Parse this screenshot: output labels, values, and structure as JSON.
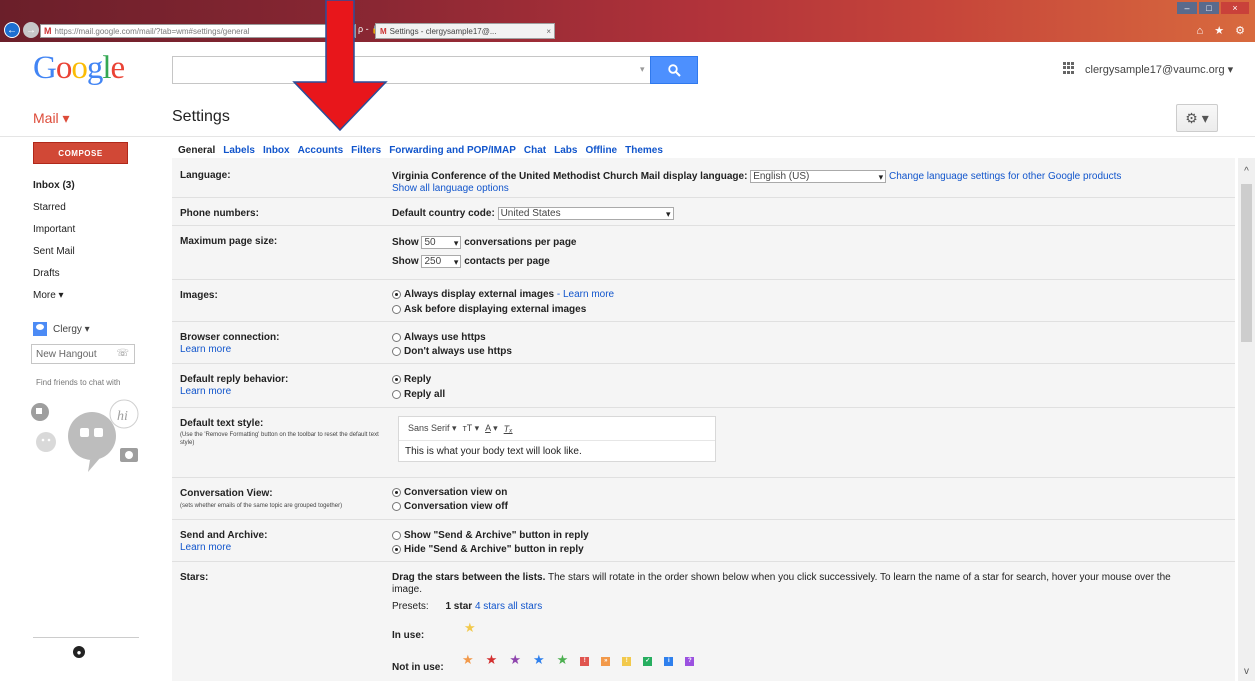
{
  "browser": {
    "url": "https://mail.google.com/mail/?tab=wm#settings/general",
    "tab_title": "Settings - clergysample17@...",
    "tab_close": "×",
    "addr_controls": "ρ - 🔒 C",
    "right_icons": "⌂ ★ ⚙"
  },
  "header": {
    "logo": "Google",
    "account": "clergysample17@vaumc.org ▾"
  },
  "mailbar": {
    "mail_label": "Mail ▾",
    "title": "Settings",
    "gear": "⚙ ▾"
  },
  "nav": {
    "compose": "COMPOSE",
    "items": [
      "Inbox (3)",
      "Starred",
      "Important",
      "Sent Mail",
      "Drafts",
      "More ▾"
    ],
    "hangout_user": "Clergy ▾",
    "hangout_placeholder": "New Hangout",
    "find_friends": "Find friends to chat with"
  },
  "tabs": [
    "General",
    "Labels",
    "Inbox",
    "Accounts",
    "Filters",
    "Forwarding and POP/IMAP",
    "Chat",
    "Labs",
    "Offline",
    "Themes"
  ],
  "settings": {
    "language": {
      "label": "Language:",
      "prefix": "Virginia Conference of the United Methodist Church Mail display language:",
      "value": "English (US)",
      "change_link": "Change language settings for other Google products",
      "show_all": "Show all language options"
    },
    "phone": {
      "label": "Phone numbers:",
      "prefix": "Default country code:",
      "value": "United States"
    },
    "page_size": {
      "label": "Maximum page size:",
      "show": "Show",
      "conv_value": "50",
      "conv_suffix": "conversations per page",
      "contacts_value": "250",
      "contacts_suffix": "contacts per page"
    },
    "images": {
      "label": "Images:",
      "opt1": "Always display external images",
      "opt1_link": "- Learn more",
      "opt2": "Ask before displaying external images"
    },
    "browser_conn": {
      "label": "Browser connection:",
      "learn": "Learn more",
      "opt1": "Always use https",
      "opt2": "Don't always use https"
    },
    "reply": {
      "label": "Default reply behavior:",
      "learn": "Learn more",
      "opt1": "Reply",
      "opt2": "Reply all"
    },
    "text_style": {
      "label": "Default text style:",
      "note": "(Use the 'Remove Formatting' button on the toolbar to reset the default text style)",
      "font": "Sans Serif",
      "font_caret": "▾",
      "size_icon": "ᴛT",
      "size_caret": "▾",
      "color_icon": "A",
      "color_caret": "▾",
      "clear_icon": "Tₓ",
      "sample": "This is what your body text will look like."
    },
    "conversation": {
      "label": "Conversation View:",
      "note": "(sets whether emails of the same topic are grouped together)",
      "opt1": "Conversation view on",
      "opt2": "Conversation view off"
    },
    "send_archive": {
      "label": "Send and Archive:",
      "learn": "Learn more",
      "opt1": "Show \"Send & Archive\" button in reply",
      "opt2": "Hide \"Send & Archive\" button in reply"
    },
    "stars": {
      "label": "Stars:",
      "desc_bold": "Drag the stars between the lists.",
      "desc": "The stars will rotate in the order shown below when you click successively. To learn the name of a star for search, hover your mouse over the",
      "desc2": "image.",
      "presets": "Presets:",
      "preset1": "1 star",
      "preset2": "4 stars",
      "preset3": "all stars",
      "in_use": "In use:",
      "not_in_use": "Not in use:",
      "not_in_use_stars": [
        "#f2994a",
        "#d32f2f",
        "#8e44ad",
        "#2f80ed",
        "#4caf50"
      ],
      "not_in_use_squares": [
        {
          "color": "#e0544f",
          "glyph": "!"
        },
        {
          "color": "#f2994a",
          "glyph": "»"
        },
        {
          "color": "#f2c94c",
          "glyph": "!"
        },
        {
          "color": "#27ae60",
          "glyph": "✓"
        },
        {
          "color": "#2f80ed",
          "glyph": "i"
        },
        {
          "color": "#9b51e0",
          "glyph": "?"
        }
      ],
      "in_use_star_color": "#f2c94c"
    }
  },
  "colors": {
    "accent": "#15c",
    "compose": "#d14836",
    "search": "#4d90fe",
    "arrow": "#e8161b"
  }
}
